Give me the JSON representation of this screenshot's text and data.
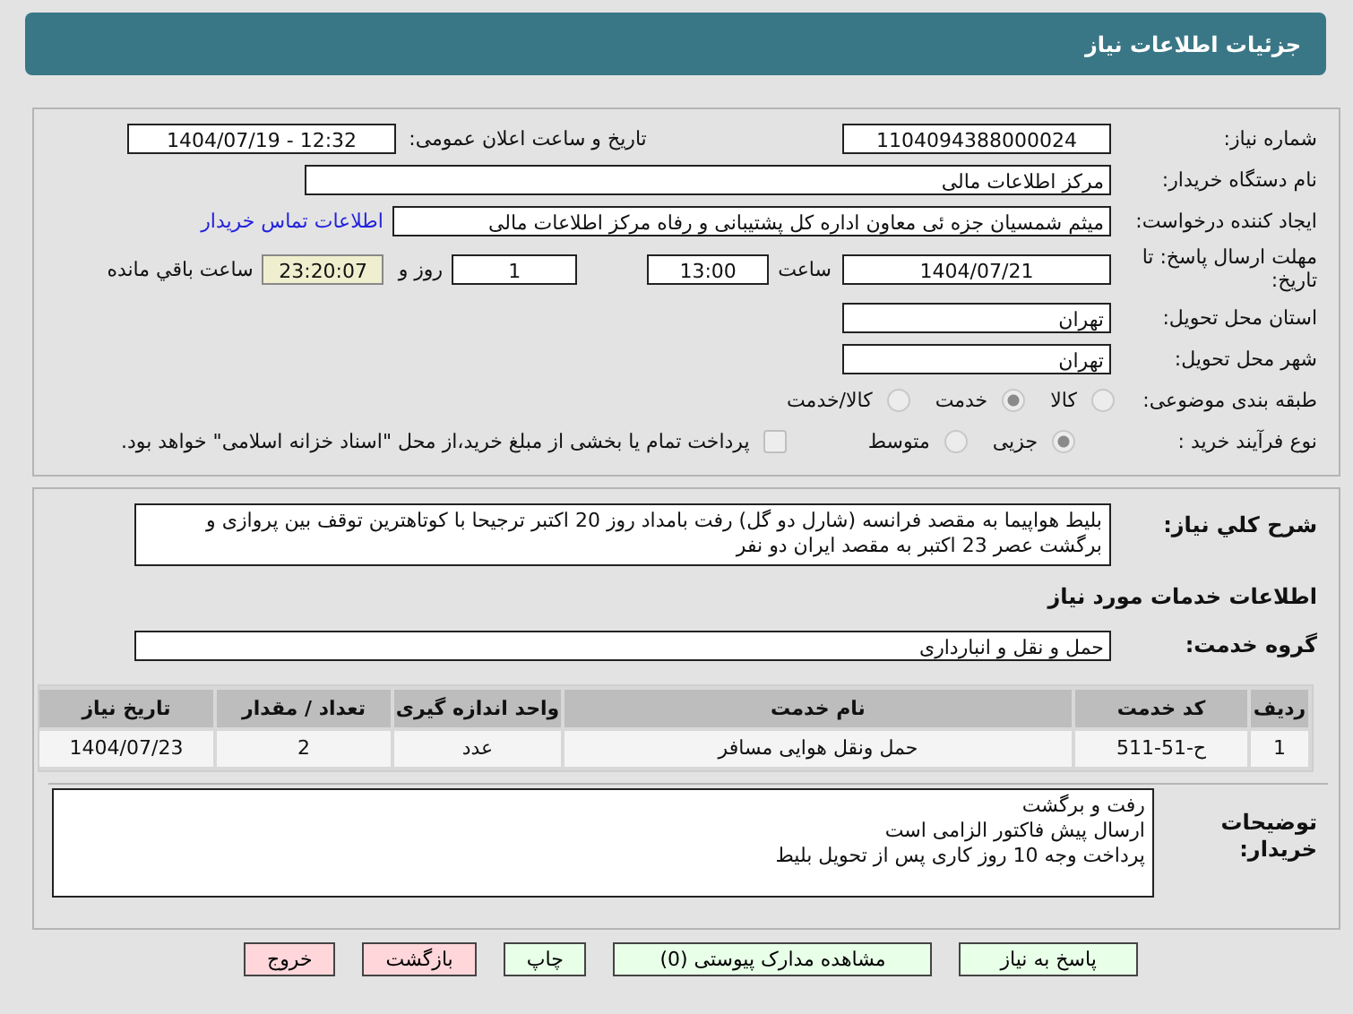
{
  "header": {
    "title": "جزئیات اطلاعات نیاز"
  },
  "need_number": {
    "label": "شماره نیاز:",
    "value": "1104094388000024"
  },
  "announce": {
    "label": "تاریخ و ساعت اعلان عمومی:",
    "value": "12:32 - 1404/07/19"
  },
  "buyer_org": {
    "label": "نام دستگاه خریدار:",
    "value": "مرکز اطلاعات مالی"
  },
  "requester": {
    "label": "ایجاد کننده درخواست:",
    "value": "میثم شمسیان جزه ئی معاون اداره کل پشتیبانی و رفاه مرکز اطلاعات مالی",
    "link": "اطلاعات تماس خریدار"
  },
  "deadline": {
    "label": "مهلت ارسال پاسخ: تا تاریخ:",
    "date": "1404/07/21",
    "time_label": "ساعت",
    "time": "13:00",
    "days": "1",
    "days_label": "روز و",
    "remaining": "23:20:07",
    "remaining_label": "ساعت باقي مانده"
  },
  "province": {
    "label": "استان محل تحویل:",
    "value": "تهران"
  },
  "city": {
    "label": "شهر محل تحویل:",
    "value": "تهران"
  },
  "category": {
    "label": "طبقه بندی موضوعی:",
    "options": [
      {
        "label": "کالا",
        "selected": false
      },
      {
        "label": "خدمت",
        "selected": true
      },
      {
        "label": "کالا/خدمت",
        "selected": false
      }
    ]
  },
  "process": {
    "label": "نوع فرآیند خرید :",
    "options": [
      {
        "label": "جزیی",
        "selected": true
      },
      {
        "label": "متوسط",
        "selected": false
      }
    ],
    "payment": {
      "checked": false,
      "text": "پرداخت تمام یا بخشی از مبلغ خرید،از محل \"اسناد خزانه اسلامی\" خواهد بود."
    }
  },
  "description": {
    "label": "شرح کلي نياز:",
    "value": "بلیط هواپیما به مقصد فرانسه (شارل دو گل) رفت بامداد روز  20 اکتبر ترجیحا با کوتاهترین توقف بین پروازی و برگشت عصر 23 اکتبر به مقصد ایران دو نفر"
  },
  "services_title": "اطلاعات خدمات مورد نياز",
  "service_group": {
    "label": "گروه خدمت:",
    "value": "حمل و نقل و انبارداری"
  },
  "table": {
    "columns": [
      "ردیف",
      "کد خدمت",
      "نام خدمت",
      "واحد اندازه گیری",
      "تعداد / مقدار",
      "تاریخ نیاز"
    ],
    "rows": [
      [
        "1",
        "ح-51-511",
        "حمل ونقل هوایی مسافر",
        "عدد",
        "2",
        "1404/07/23"
      ]
    ]
  },
  "buyer_notes": {
    "label": "توضیحات خریدار:",
    "value": "رفت و برگشت\nارسال پیش فاکتور الزامی است\nپرداخت وجه 10 روز کاری پس از تحویل بلیط"
  },
  "buttons": [
    {
      "label": "پاسخ به نیاز",
      "kind": "primary"
    },
    {
      "label": "مشاهده مدارک پیوستی (0)",
      "kind": "primary"
    },
    {
      "label": "چاپ",
      "kind": "primary"
    },
    {
      "label": "بازگشت",
      "kind": "danger"
    },
    {
      "label": "خروج",
      "kind": "danger"
    }
  ]
}
